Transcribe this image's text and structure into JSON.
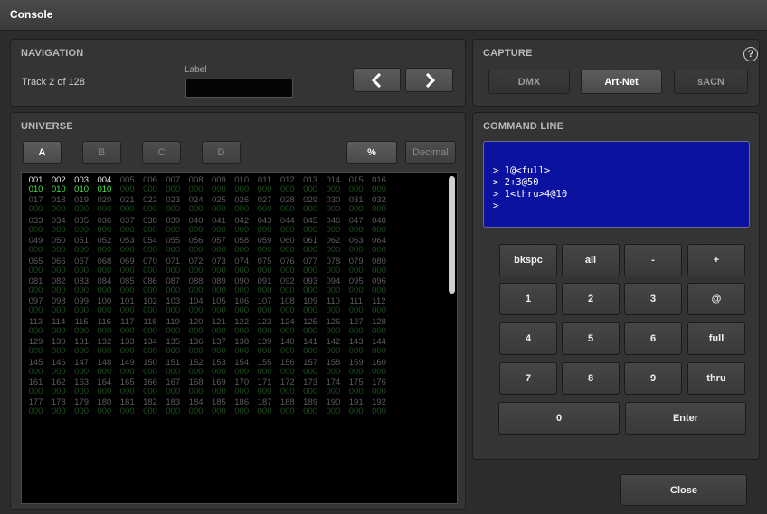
{
  "window": {
    "title": "Console"
  },
  "navigation": {
    "title": "NAVIGATION",
    "track": "Track 2 of 128",
    "label_caption": "Label",
    "label_value": "",
    "prev_icon": "chevron-left-icon",
    "next_icon": "chevron-right-icon"
  },
  "capture": {
    "title": "CAPTURE",
    "help": "?",
    "buttons": [
      "DMX",
      "Art-Net",
      "sACN"
    ],
    "selected": "Art-Net"
  },
  "universe": {
    "title": "UNIVERSE",
    "tabs": [
      "A",
      "B",
      "C",
      "D"
    ],
    "selected_tab": "A",
    "percent_label": "%",
    "decimal_label": "Decimal",
    "channels_start": 1,
    "channels_visible_end": 192,
    "active_channels": [
      1,
      2,
      3,
      4
    ],
    "active_value": "010",
    "default_value": "000"
  },
  "command_line": {
    "title": "COMMAND LINE",
    "lines": [
      "> 1@<full>",
      "> 2+3@50",
      "> 1<thru>4@10",
      ">"
    ],
    "keys": [
      [
        "bkspc",
        "all",
        "-",
        "+"
      ],
      [
        "1",
        "2",
        "3",
        "@"
      ],
      [
        "4",
        "5",
        "6",
        "full"
      ],
      [
        "7",
        "8",
        "9",
        "thru"
      ]
    ],
    "zero_label": "0",
    "enter_label": "Enter"
  },
  "close_label": "Close"
}
